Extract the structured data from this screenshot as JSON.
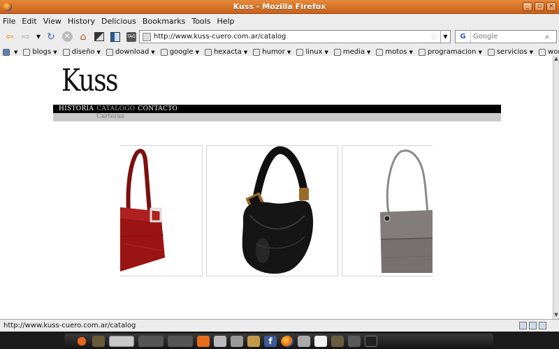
{
  "window": {
    "title": "Kuss - Mozilla Firefox",
    "controls": [
      "_",
      "▫",
      "×"
    ]
  },
  "menu": [
    "File",
    "Edit",
    "View",
    "History",
    "Delicious",
    "Bookmarks",
    "Tools",
    "Help"
  ],
  "url": "http://www.kuss-cuero.com.ar/catalog",
  "search": {
    "engine": "G",
    "placeholder": "Google"
  },
  "bookmarks": [
    "blogs",
    "diseño",
    "download",
    "google",
    "hexacta",
    "humor",
    "linux",
    "media",
    "motos",
    "programacion",
    "servicios",
    "work"
  ],
  "site": {
    "logo": "Kuss",
    "nav": [
      {
        "label": "HISTORIA",
        "active": false
      },
      {
        "label": "CATALOGO",
        "active": true
      },
      {
        "label": "CONTACTO",
        "active": false
      }
    ],
    "subnav": "Carteras"
  },
  "status": "http://www.kuss-cuero.com.ar/catalog",
  "colors": {
    "titlebar": "#d6712a",
    "sitenav_bg": "#000000",
    "subnav_bg": "#c9c9c9",
    "bag_red": "#9b1414",
    "bag_black": "#151515",
    "bag_gray": "#777070"
  }
}
